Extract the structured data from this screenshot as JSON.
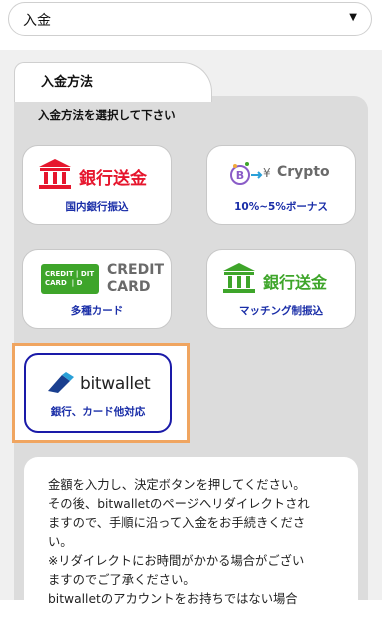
{
  "select": {
    "value": "入金"
  },
  "tab": {
    "label": "入金方法"
  },
  "instruction": "入金方法を選択して下さい",
  "options": [
    {
      "logo_text": "銀行送金",
      "caption": "国内銀行振込"
    },
    {
      "logo_text": "Crypto",
      "symbol": "¥",
      "caption": "10%~5%ボーナス"
    },
    {
      "logo_card_text": "CREDIT\nCARD",
      "logo_text_line1": "CREDIT",
      "logo_text_line2": "CARD",
      "caption": "多種カード"
    },
    {
      "logo_text": "銀行送金",
      "caption": "マッチング制振込"
    },
    {
      "logo_text": "bitwallet",
      "caption": "銀行、カード他対応"
    }
  ],
  "notice": {
    "lines": [
      "金額を入力し、決定ボタンを押してください。",
      "その後、bitwalletのページへリダイレクトされ",
      "ますので、手順に沿って入金をお手続きくださ",
      "い。",
      "※リダイレクトにお時間がかかる場合がござい",
      "ますのでご了承ください。",
      "bitwalletのアカウントをお持ちではない場合"
    ]
  },
  "colors": {
    "accent_red": "#e6162d",
    "accent_green": "#3ea52a",
    "caption_blue": "#1a2ea8",
    "highlight_orange": "#f0a560"
  }
}
